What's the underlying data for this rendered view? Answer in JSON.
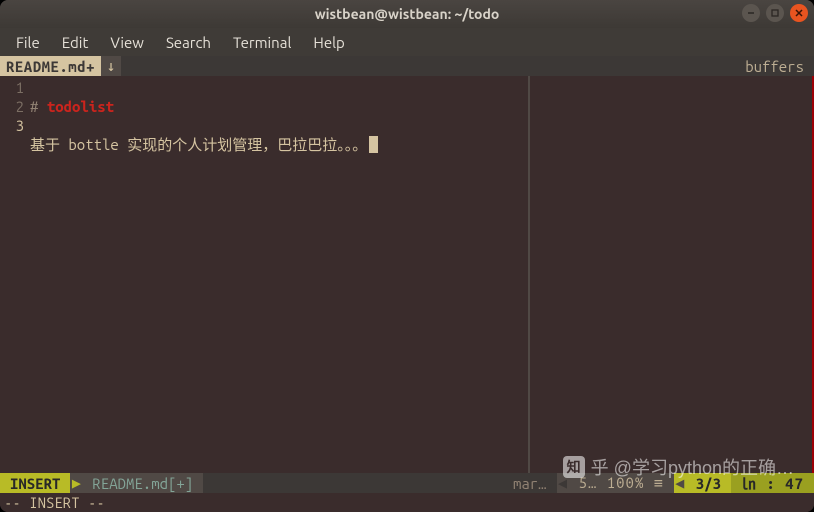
{
  "window": {
    "title": "wistbean@wistbean: ~/todo"
  },
  "menu": {
    "items": [
      "File",
      "Edit",
      "View",
      "Search",
      "Terminal",
      "Help"
    ]
  },
  "tabline": {
    "active": "README.md+",
    "right": "buffers"
  },
  "lines": {
    "n1": "1",
    "n2": "2",
    "n3": "3",
    "l1_hash": "#",
    "l1_head": "todolist",
    "l3": "基于 bottle 实现的个人计划管理，巴拉巴拉。。。"
  },
  "status": {
    "mode": "INSERT",
    "file": "README.md[+]",
    "filetype": "mar…",
    "encoding": "5… 100% ≡",
    "percent": "3/3",
    "position": "㏑ : 47"
  },
  "cmd": "-- INSERT --",
  "watermark": {
    "logo": "知",
    "text": "乎 @学习python的正确…"
  }
}
